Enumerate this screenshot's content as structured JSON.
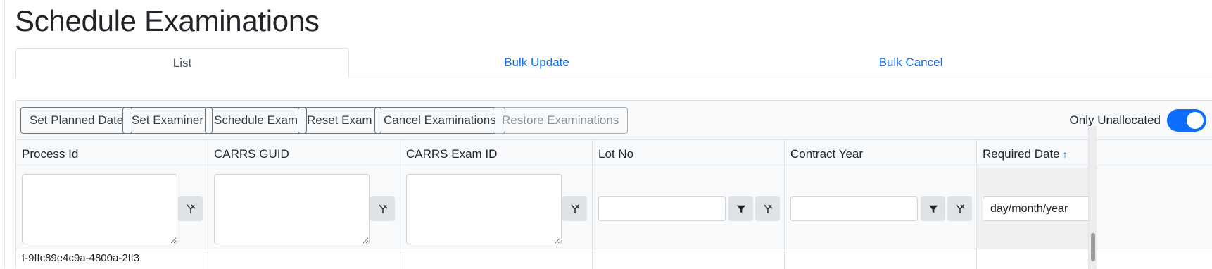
{
  "page": {
    "title": "Schedule Examinations"
  },
  "tabs": [
    {
      "label": "List",
      "active": true
    },
    {
      "label": "Bulk Update",
      "active": false
    },
    {
      "label": "Bulk Cancel",
      "active": false
    }
  ],
  "toolbar": {
    "buttons": [
      {
        "label": "Set Planned Date",
        "enabled": true
      },
      {
        "label": "Set Examiner",
        "enabled": true
      },
      {
        "label": "Schedule Exam",
        "enabled": true
      },
      {
        "label": "Reset Exam",
        "enabled": true
      },
      {
        "label": "Cancel Examinations",
        "enabled": true
      },
      {
        "label": "Restore Examinations",
        "enabled": false
      }
    ],
    "only_unallocated": {
      "label": "Only Unallocated",
      "checked": true
    }
  },
  "table": {
    "columns": [
      {
        "header": "Process Id",
        "filter_type": "textarea",
        "filter_value": ""
      },
      {
        "header": "CARRS GUID",
        "filter_type": "textarea",
        "filter_value": ""
      },
      {
        "header": "CARRS Exam ID",
        "filter_type": "textarea",
        "filter_value": ""
      },
      {
        "header": "Lot No",
        "filter_type": "text",
        "filter_value": ""
      },
      {
        "header": "Contract Year",
        "filter_type": "text",
        "filter_value": ""
      },
      {
        "header": "Required Date",
        "filter_type": "date",
        "filter_placeholder": "day/month/year",
        "sorted": "ascending"
      }
    ],
    "sort_icon": "arrow-up-icon",
    "filter_icon": "funnel-icon",
    "clear_filter_icon": "filter-clear-icon",
    "rows": [
      {
        "cells": [
          "f-9ffc89e4c9a-4800a-2ff3",
          "",
          "",
          "",
          "",
          ""
        ]
      }
    ]
  },
  "colors": {
    "accent": "#0d6efd",
    "toolbar_bg": "#f8f9fa",
    "icon_button_bg": "#dfe3e7"
  }
}
